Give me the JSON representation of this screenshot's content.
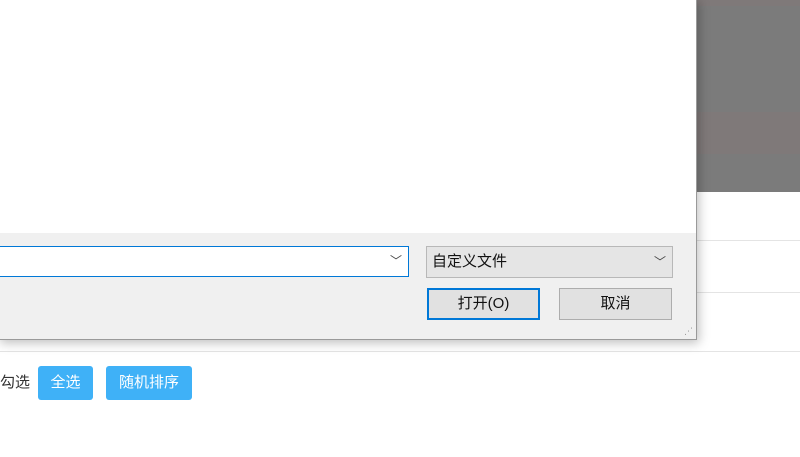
{
  "dialog": {
    "filename_value": "",
    "filetype_selected": "自定义文件",
    "open_label": "打开(O)",
    "cancel_label": "取消"
  },
  "page": {
    "check_label": "勾选",
    "select_all_label": "全选",
    "shuffle_label": "随机排序"
  },
  "icons": {
    "dropdown": "chevron-down-icon",
    "resize": "resize-grip-icon"
  },
  "colors": {
    "accent": "#0078d7",
    "page_button": "#3fb1f7",
    "background_image": "#7b7b7b"
  }
}
